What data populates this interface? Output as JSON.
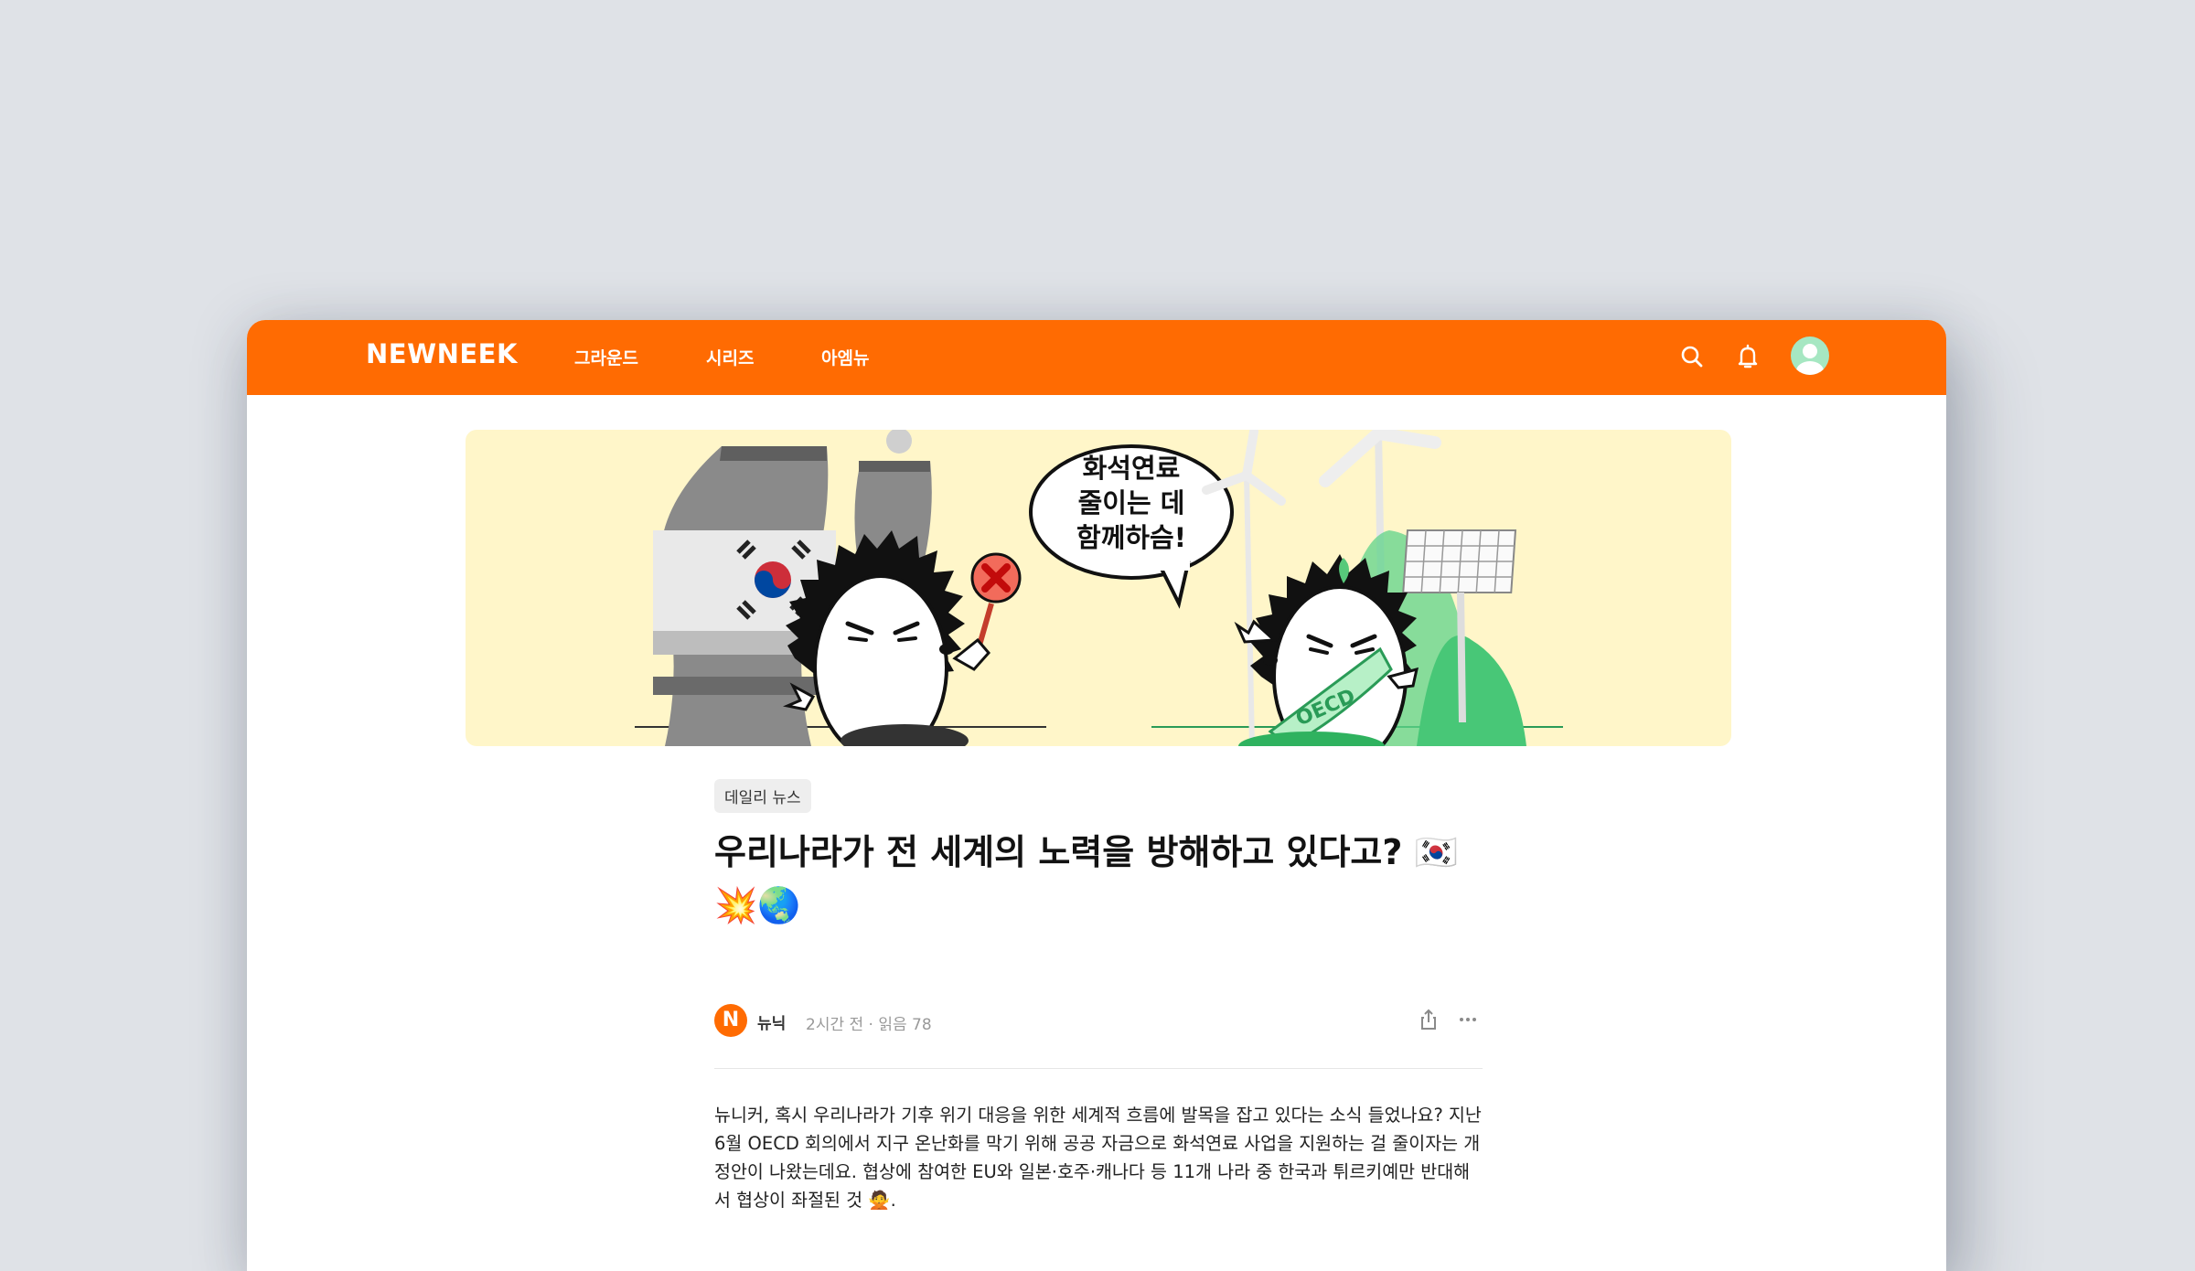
{
  "header": {
    "logo": "NEWNEEK",
    "nav": [
      "그라운드",
      "시리즈",
      "아엠뉴"
    ],
    "icons": [
      "search-icon",
      "bell-icon",
      "avatar"
    ],
    "accent_color": "#ff6b02"
  },
  "hero": {
    "speech_bubble": [
      "화석연료",
      "줄이는 데",
      "함께하슴!"
    ],
    "sash_text": "OECD"
  },
  "article": {
    "category": "데일리 뉴스",
    "title": "우리나라가 전 세계의 노력을 방해하고 있다고? 🇰🇷💥🌏",
    "author_initial": "N",
    "author": "뉴닉",
    "meta": "2시간 전 · 읽음 78",
    "body": "뉴니커, 혹시 우리나라가 기후 위기 대응을 위한 세계적 흐름에 발목을 잡고 있다는 소식 들었나요? 지난 6월 OECD 회의에서 지구 온난화를 막기 위해 공공 자금으로 화석연료 사업을 지원하는 걸 줄이자는 개정안이 나왔는데요. 협상에 참여한 EU와 일본·호주·캐나다 등 11개 나라 중 한국과 튀르키예만 반대해서 협상이 좌절된 것 🙅."
  }
}
